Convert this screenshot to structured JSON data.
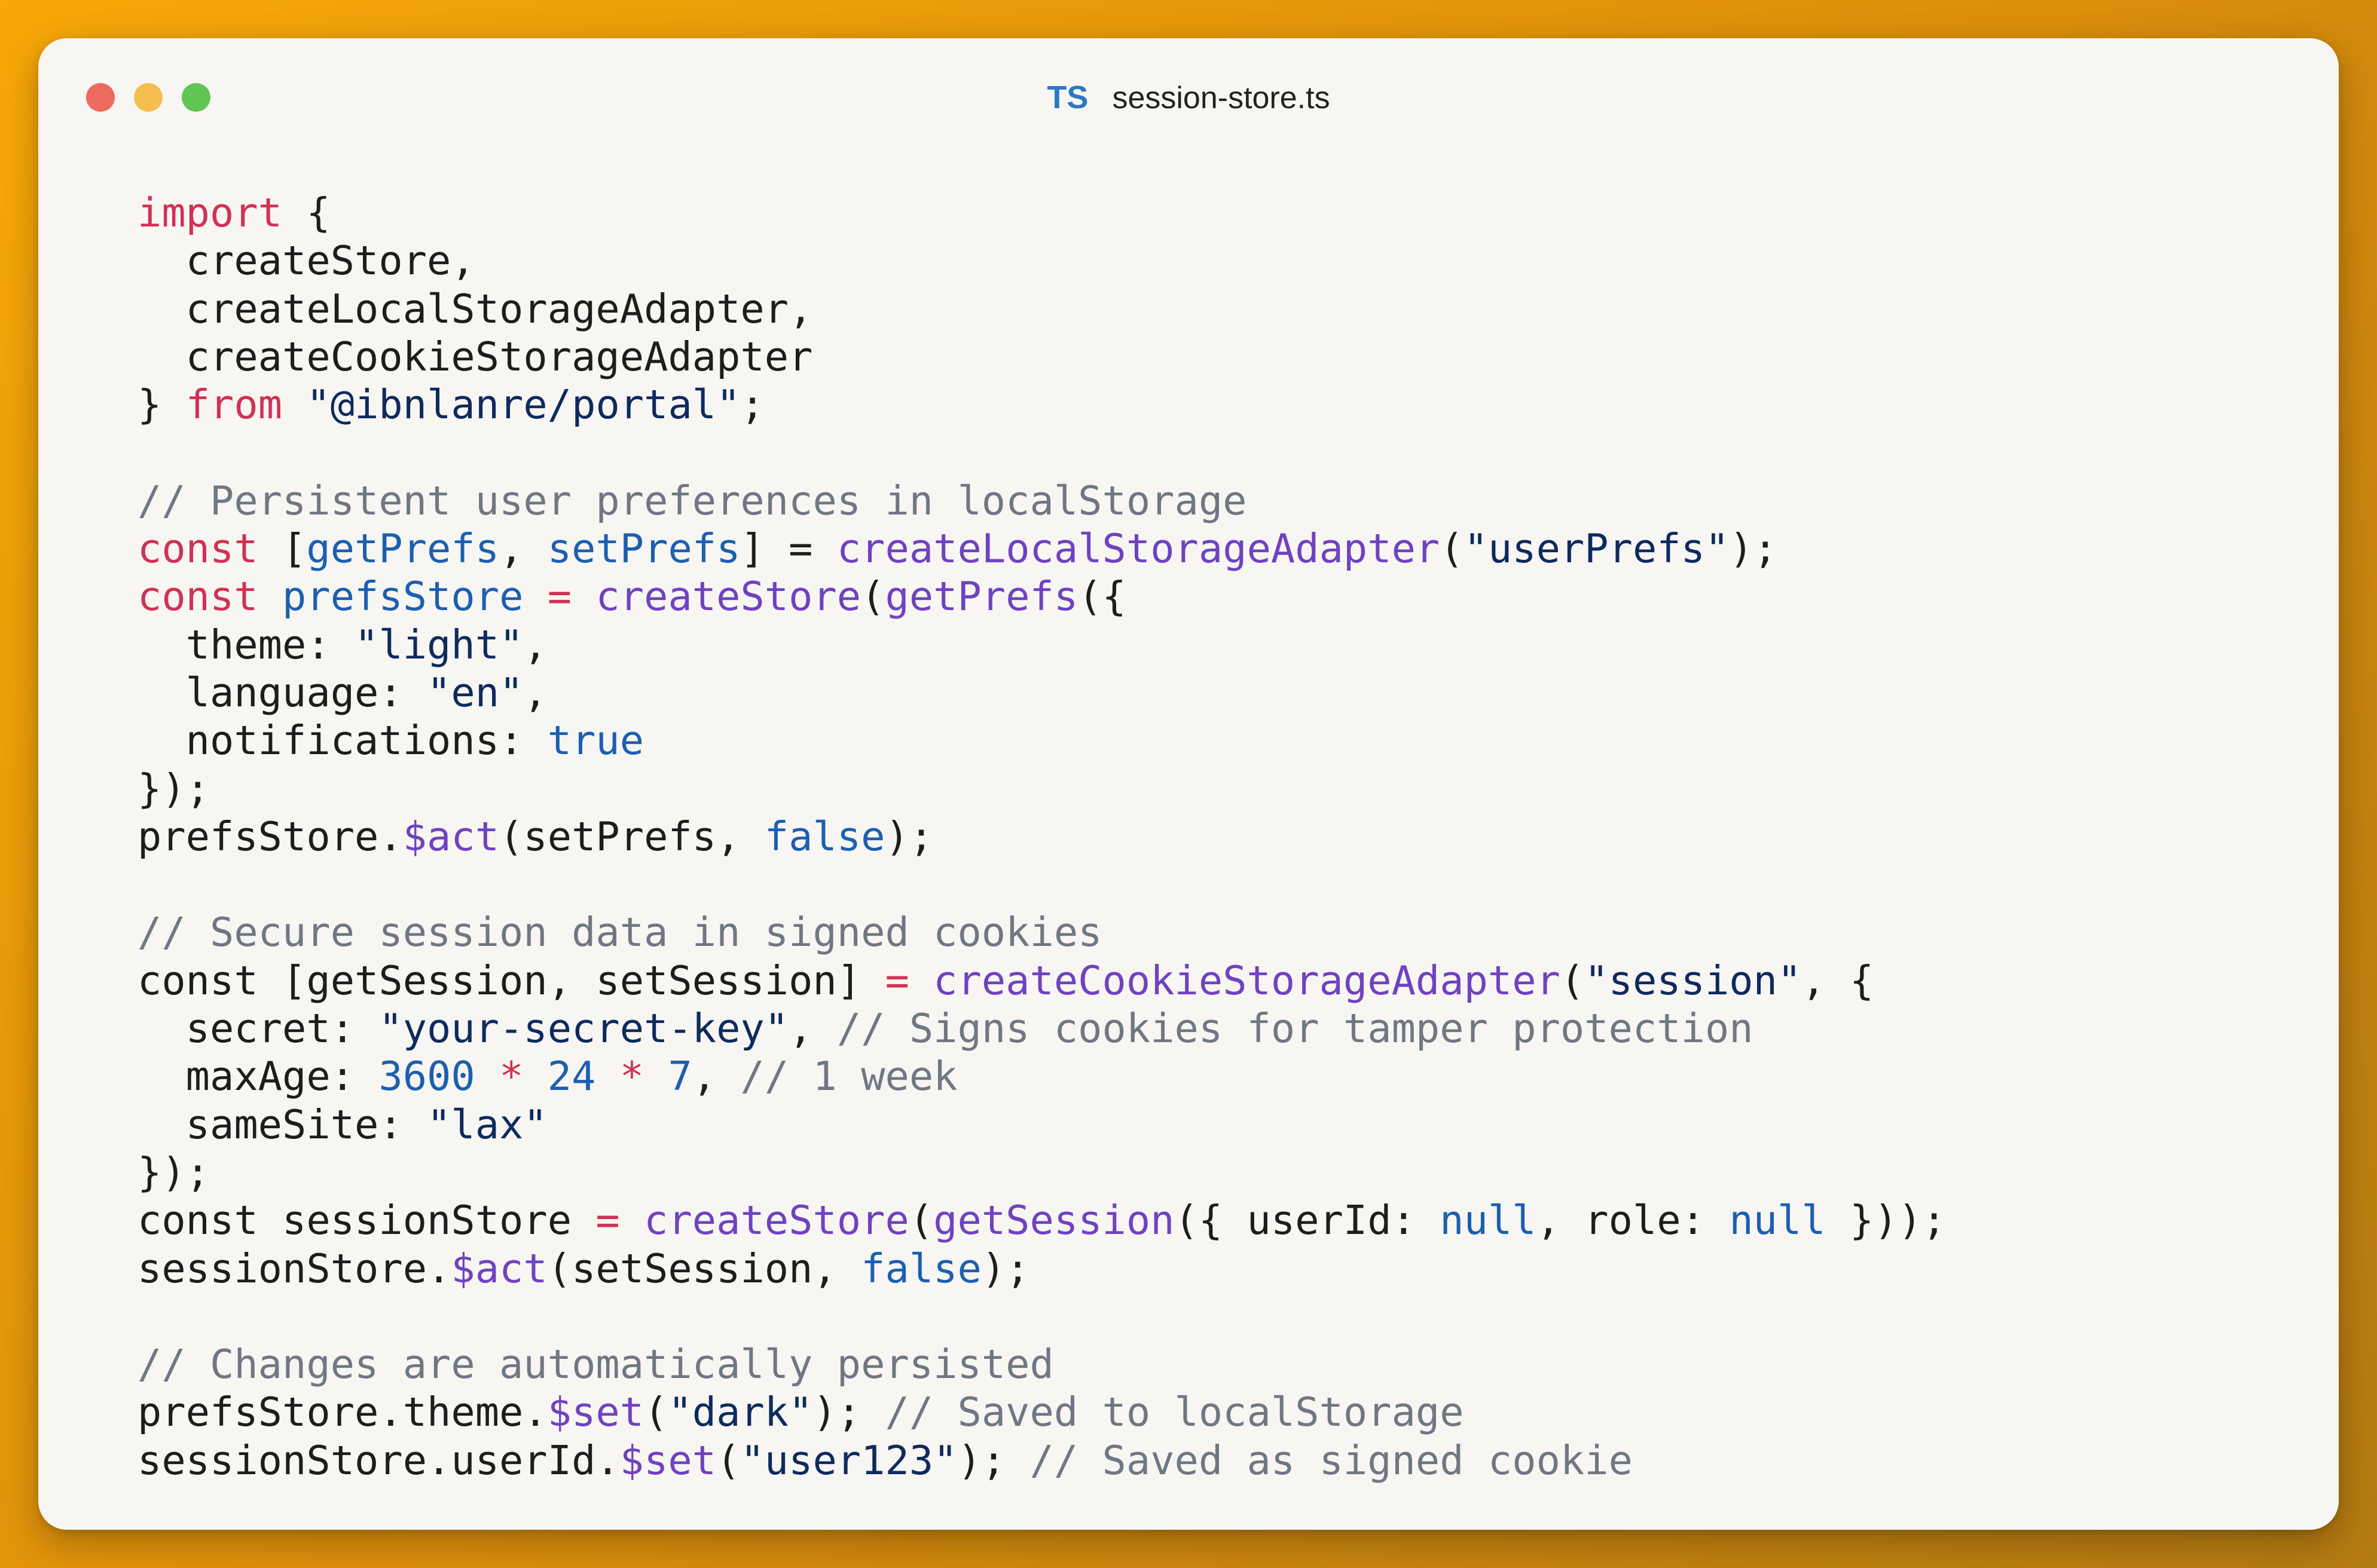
{
  "window": {
    "title": "session-store.ts",
    "lang_badge": "TS"
  },
  "colors": {
    "background_start": "#f7a707",
    "background_end": "#b47a12",
    "keyword": "#d13155",
    "string": "#0e2a5e",
    "function": "#6f42c1",
    "variable": "#1c5fb0",
    "comment": "#707782",
    "plain": "#1d1d1d"
  },
  "code": {
    "lines": [
      [
        {
          "t": "kw",
          "v": "import"
        },
        {
          "t": "pl",
          "v": " {"
        }
      ],
      [
        {
          "t": "pl",
          "v": "  createStore,"
        }
      ],
      [
        {
          "t": "pl",
          "v": "  createLocalStorageAdapter,"
        }
      ],
      [
        {
          "t": "pl",
          "v": "  createCookieStorageAdapter"
        }
      ],
      [
        {
          "t": "pl",
          "v": "} "
        },
        {
          "t": "kw",
          "v": "from"
        },
        {
          "t": "pl",
          "v": " "
        },
        {
          "t": "str",
          "v": "\"@ibnlanre/portal\""
        },
        {
          "t": "pl",
          "v": ";"
        }
      ],
      [],
      [
        {
          "t": "cmt",
          "v": "// Persistent user preferences in localStorage"
        }
      ],
      [
        {
          "t": "kw",
          "v": "const"
        },
        {
          "t": "pl",
          "v": " ["
        },
        {
          "t": "var",
          "v": "getPrefs"
        },
        {
          "t": "pl",
          "v": ", "
        },
        {
          "t": "var",
          "v": "setPrefs"
        },
        {
          "t": "pl",
          "v": "] = "
        },
        {
          "t": "fn",
          "v": "createLocalStorageAdapter"
        },
        {
          "t": "pl",
          "v": "("
        },
        {
          "t": "str",
          "v": "\"userPrefs\""
        },
        {
          "t": "pl",
          "v": ");"
        }
      ],
      [
        {
          "t": "kw",
          "v": "const"
        },
        {
          "t": "pl",
          "v": " "
        },
        {
          "t": "var",
          "v": "prefsStore"
        },
        {
          "t": "pl",
          "v": " "
        },
        {
          "t": "op",
          "v": "="
        },
        {
          "t": "pl",
          "v": " "
        },
        {
          "t": "fn",
          "v": "createStore"
        },
        {
          "t": "pl",
          "v": "("
        },
        {
          "t": "fn",
          "v": "getPrefs"
        },
        {
          "t": "pl",
          "v": "({"
        }
      ],
      [
        {
          "t": "pl",
          "v": "  theme: "
        },
        {
          "t": "str",
          "v": "\"light\""
        },
        {
          "t": "pl",
          "v": ","
        }
      ],
      [
        {
          "t": "pl",
          "v": "  language: "
        },
        {
          "t": "str",
          "v": "\"en\""
        },
        {
          "t": "pl",
          "v": ","
        }
      ],
      [
        {
          "t": "pl",
          "v": "  notifications: "
        },
        {
          "t": "lit",
          "v": "true"
        }
      ],
      [
        {
          "t": "pl",
          "v": "});"
        }
      ],
      [
        {
          "t": "pl",
          "v": "prefsStore."
        },
        {
          "t": "fn",
          "v": "$act"
        },
        {
          "t": "pl",
          "v": "(setPrefs, "
        },
        {
          "t": "lit",
          "v": "false"
        },
        {
          "t": "pl",
          "v": ");"
        }
      ],
      [],
      [
        {
          "t": "cmt",
          "v": "// Secure session data in signed cookies"
        }
      ],
      [
        {
          "t": "pl",
          "v": "const [getSession, setSession] "
        },
        {
          "t": "op",
          "v": "="
        },
        {
          "t": "pl",
          "v": " "
        },
        {
          "t": "fn",
          "v": "createCookieStorageAdapter"
        },
        {
          "t": "pl",
          "v": "("
        },
        {
          "t": "str",
          "v": "\"session\""
        },
        {
          "t": "pl",
          "v": ", {"
        }
      ],
      [
        {
          "t": "pl",
          "v": "  secret: "
        },
        {
          "t": "str",
          "v": "\"your-secret-key\""
        },
        {
          "t": "pl",
          "v": ", "
        },
        {
          "t": "cmt",
          "v": "// Signs cookies for tamper protection"
        }
      ],
      [
        {
          "t": "pl",
          "v": "  maxAge: "
        },
        {
          "t": "lit",
          "v": "3600"
        },
        {
          "t": "pl",
          "v": " "
        },
        {
          "t": "op",
          "v": "*"
        },
        {
          "t": "pl",
          "v": " "
        },
        {
          "t": "lit",
          "v": "24"
        },
        {
          "t": "pl",
          "v": " "
        },
        {
          "t": "op",
          "v": "*"
        },
        {
          "t": "pl",
          "v": " "
        },
        {
          "t": "lit",
          "v": "7"
        },
        {
          "t": "pl",
          "v": ", "
        },
        {
          "t": "cmt",
          "v": "// 1 week"
        }
      ],
      [
        {
          "t": "pl",
          "v": "  sameSite: "
        },
        {
          "t": "str",
          "v": "\"lax\""
        }
      ],
      [
        {
          "t": "pl",
          "v": "});"
        }
      ],
      [
        {
          "t": "pl",
          "v": "const sessionStore "
        },
        {
          "t": "op",
          "v": "="
        },
        {
          "t": "pl",
          "v": " "
        },
        {
          "t": "fn",
          "v": "createStore"
        },
        {
          "t": "pl",
          "v": "("
        },
        {
          "t": "fn",
          "v": "getSession"
        },
        {
          "t": "pl",
          "v": "({ userId: "
        },
        {
          "t": "lit",
          "v": "null"
        },
        {
          "t": "pl",
          "v": ", role: "
        },
        {
          "t": "lit",
          "v": "null"
        },
        {
          "t": "pl",
          "v": " }));"
        }
      ],
      [
        {
          "t": "pl",
          "v": "sessionStore."
        },
        {
          "t": "fn",
          "v": "$act"
        },
        {
          "t": "pl",
          "v": "(setSession, "
        },
        {
          "t": "lit",
          "v": "false"
        },
        {
          "t": "pl",
          "v": ");"
        }
      ],
      [],
      [
        {
          "t": "cmt",
          "v": "// Changes are automatically persisted"
        }
      ],
      [
        {
          "t": "pl",
          "v": "prefsStore.theme."
        },
        {
          "t": "fn",
          "v": "$set"
        },
        {
          "t": "pl",
          "v": "("
        },
        {
          "t": "str",
          "v": "\"dark\""
        },
        {
          "t": "pl",
          "v": "); "
        },
        {
          "t": "cmt",
          "v": "// Saved to localStorage"
        }
      ],
      [
        {
          "t": "pl",
          "v": "sessionStore.userId."
        },
        {
          "t": "fn",
          "v": "$set"
        },
        {
          "t": "pl",
          "v": "("
        },
        {
          "t": "str",
          "v": "\"user123\""
        },
        {
          "t": "pl",
          "v": "); "
        },
        {
          "t": "cmt",
          "v": "// Saved as signed cookie"
        }
      ]
    ]
  }
}
